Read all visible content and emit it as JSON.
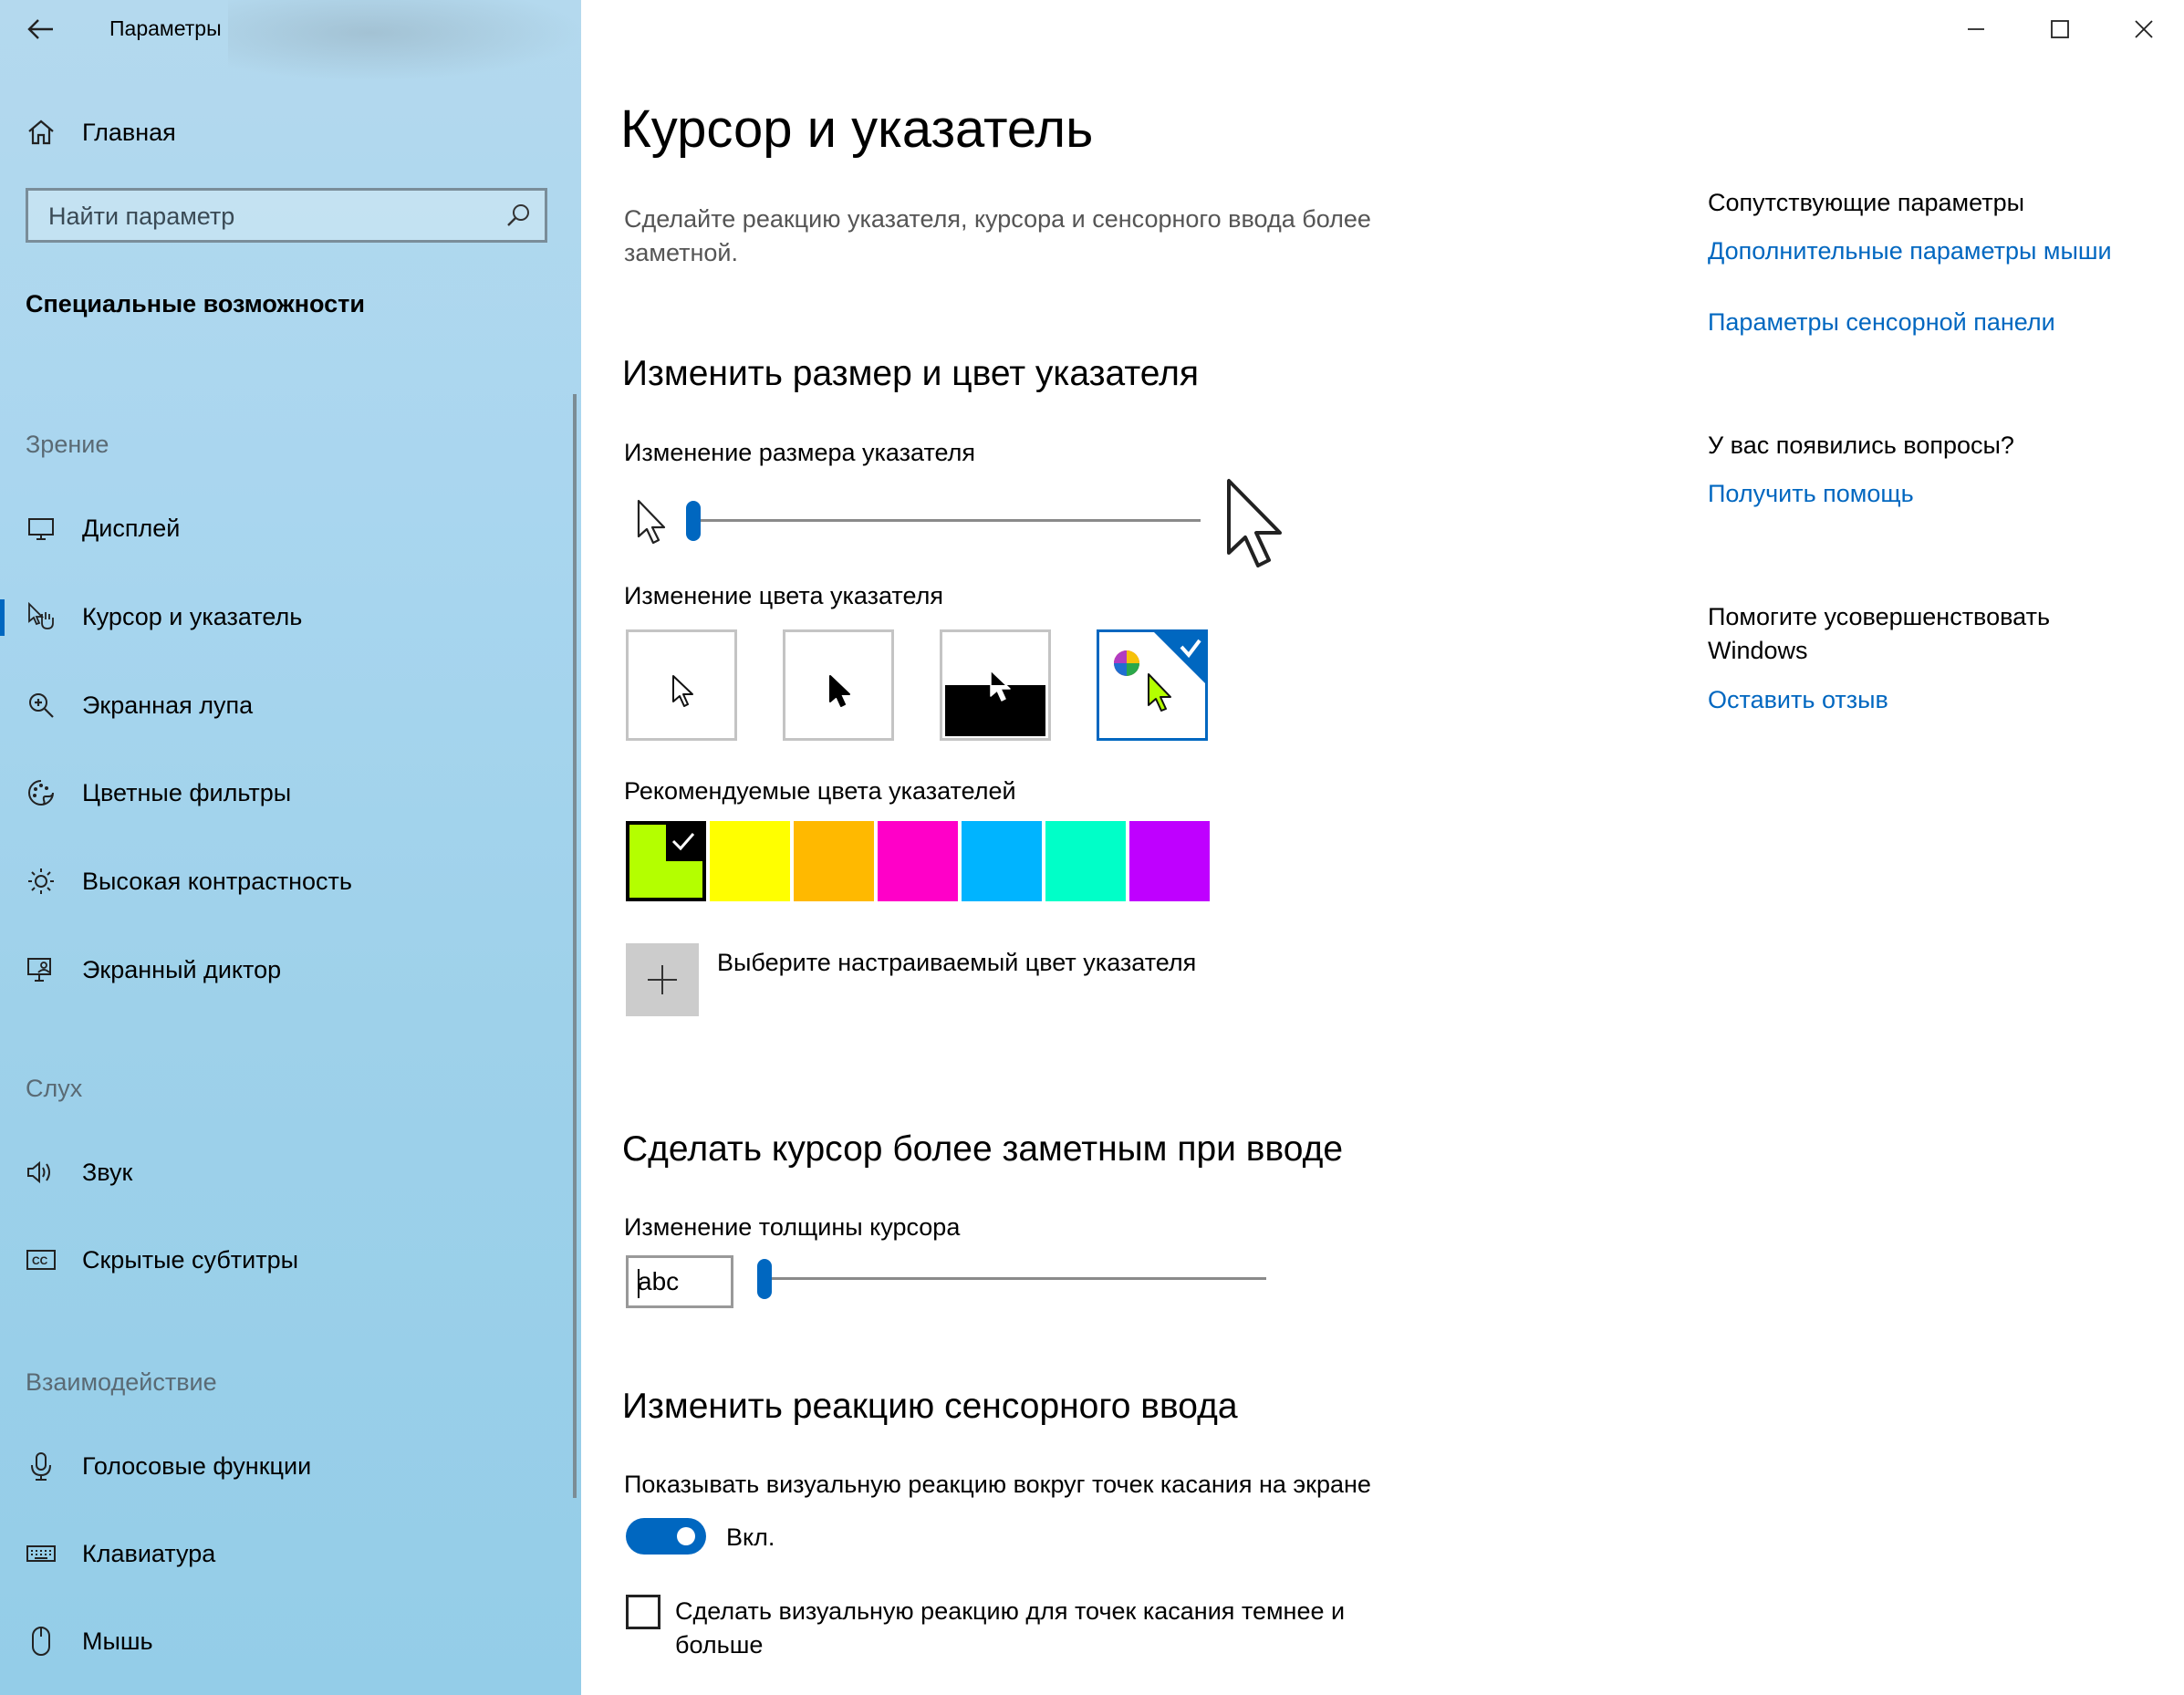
{
  "window": {
    "app_title": "Параметры",
    "minimize_icon": "minimize-icon",
    "maximize_icon": "maximize-icon",
    "close_icon": "close-icon"
  },
  "sidebar": {
    "home_label": "Главная",
    "search_placeholder": "Найти параметр",
    "category_heading": "Специальные возможности",
    "groups": {
      "vision": "Зрение",
      "hearing": "Слух",
      "interaction": "Взаимодействие"
    },
    "items": [
      {
        "label": "Дисплей",
        "icon": "display-icon"
      },
      {
        "label": "Курсор и указатель",
        "icon": "cursor-pointer-icon",
        "active": true
      },
      {
        "label": "Экранная лупа",
        "icon": "magnifier-icon"
      },
      {
        "label": "Цветные фильтры",
        "icon": "color-filters-icon"
      },
      {
        "label": "Высокая контрастность",
        "icon": "high-contrast-icon"
      },
      {
        "label": "Экранный диктор",
        "icon": "narrator-icon"
      },
      {
        "label": "Звук",
        "icon": "sound-icon"
      },
      {
        "label": "Скрытые субтитры",
        "icon": "closed-captions-icon"
      },
      {
        "label": "Голосовые функции",
        "icon": "microphone-icon"
      },
      {
        "label": "Клавиатура",
        "icon": "keyboard-icon"
      },
      {
        "label": "Мышь",
        "icon": "mouse-icon"
      }
    ]
  },
  "main": {
    "title": "Курсор и указатель",
    "description": "Сделайте реакцию указателя, курсора и сенсорного ввода более заметной.",
    "pointer_section": {
      "title": "Изменить размер и цвет указателя",
      "size_label": "Изменение размера указателя",
      "size_level": 1,
      "color_label": "Изменение цвета указателя",
      "color_options": [
        "white",
        "black",
        "inverted",
        "custom"
      ],
      "selected_color_option": "custom",
      "recommended_label": "Рекомендуемые цвета указателей",
      "recommended_colors": [
        "#b4ff00",
        "#ffff00",
        "#ffb900",
        "#ff00c8",
        "#00b4ff",
        "#00ffc8",
        "#bf00ff"
      ],
      "selected_recommended": 0,
      "custom_color_label": "Выберите настраиваемый цвет указателя"
    },
    "cursor_section": {
      "title": "Сделать курсор более заметным при вводе",
      "thickness_label": "Изменение толщины курсора",
      "preview_text": "abc",
      "thickness_level": 1
    },
    "touch_section": {
      "title": "Изменить реакцию сенсорного ввода",
      "show_feedback_label": "Показывать визуальную реакцию вокруг точек касания на экране",
      "toggle_state": "Вкл.",
      "darker_label": "Сделать визуальную реакцию для точек касания темнее и больше",
      "darker_checked": false
    }
  },
  "related": {
    "heading": "Сопутствующие параметры",
    "link_mouse": "Дополнительные параметры мыши",
    "link_touchpad": "Параметры сенсорной панели",
    "questions_heading": "У вас появились вопросы?",
    "link_help": "Получить помощь",
    "improve_heading": "Помогите усовершенствовать Windows",
    "link_feedback": "Оставить отзыв"
  },
  "colors": {
    "accent": "#0067c0"
  }
}
